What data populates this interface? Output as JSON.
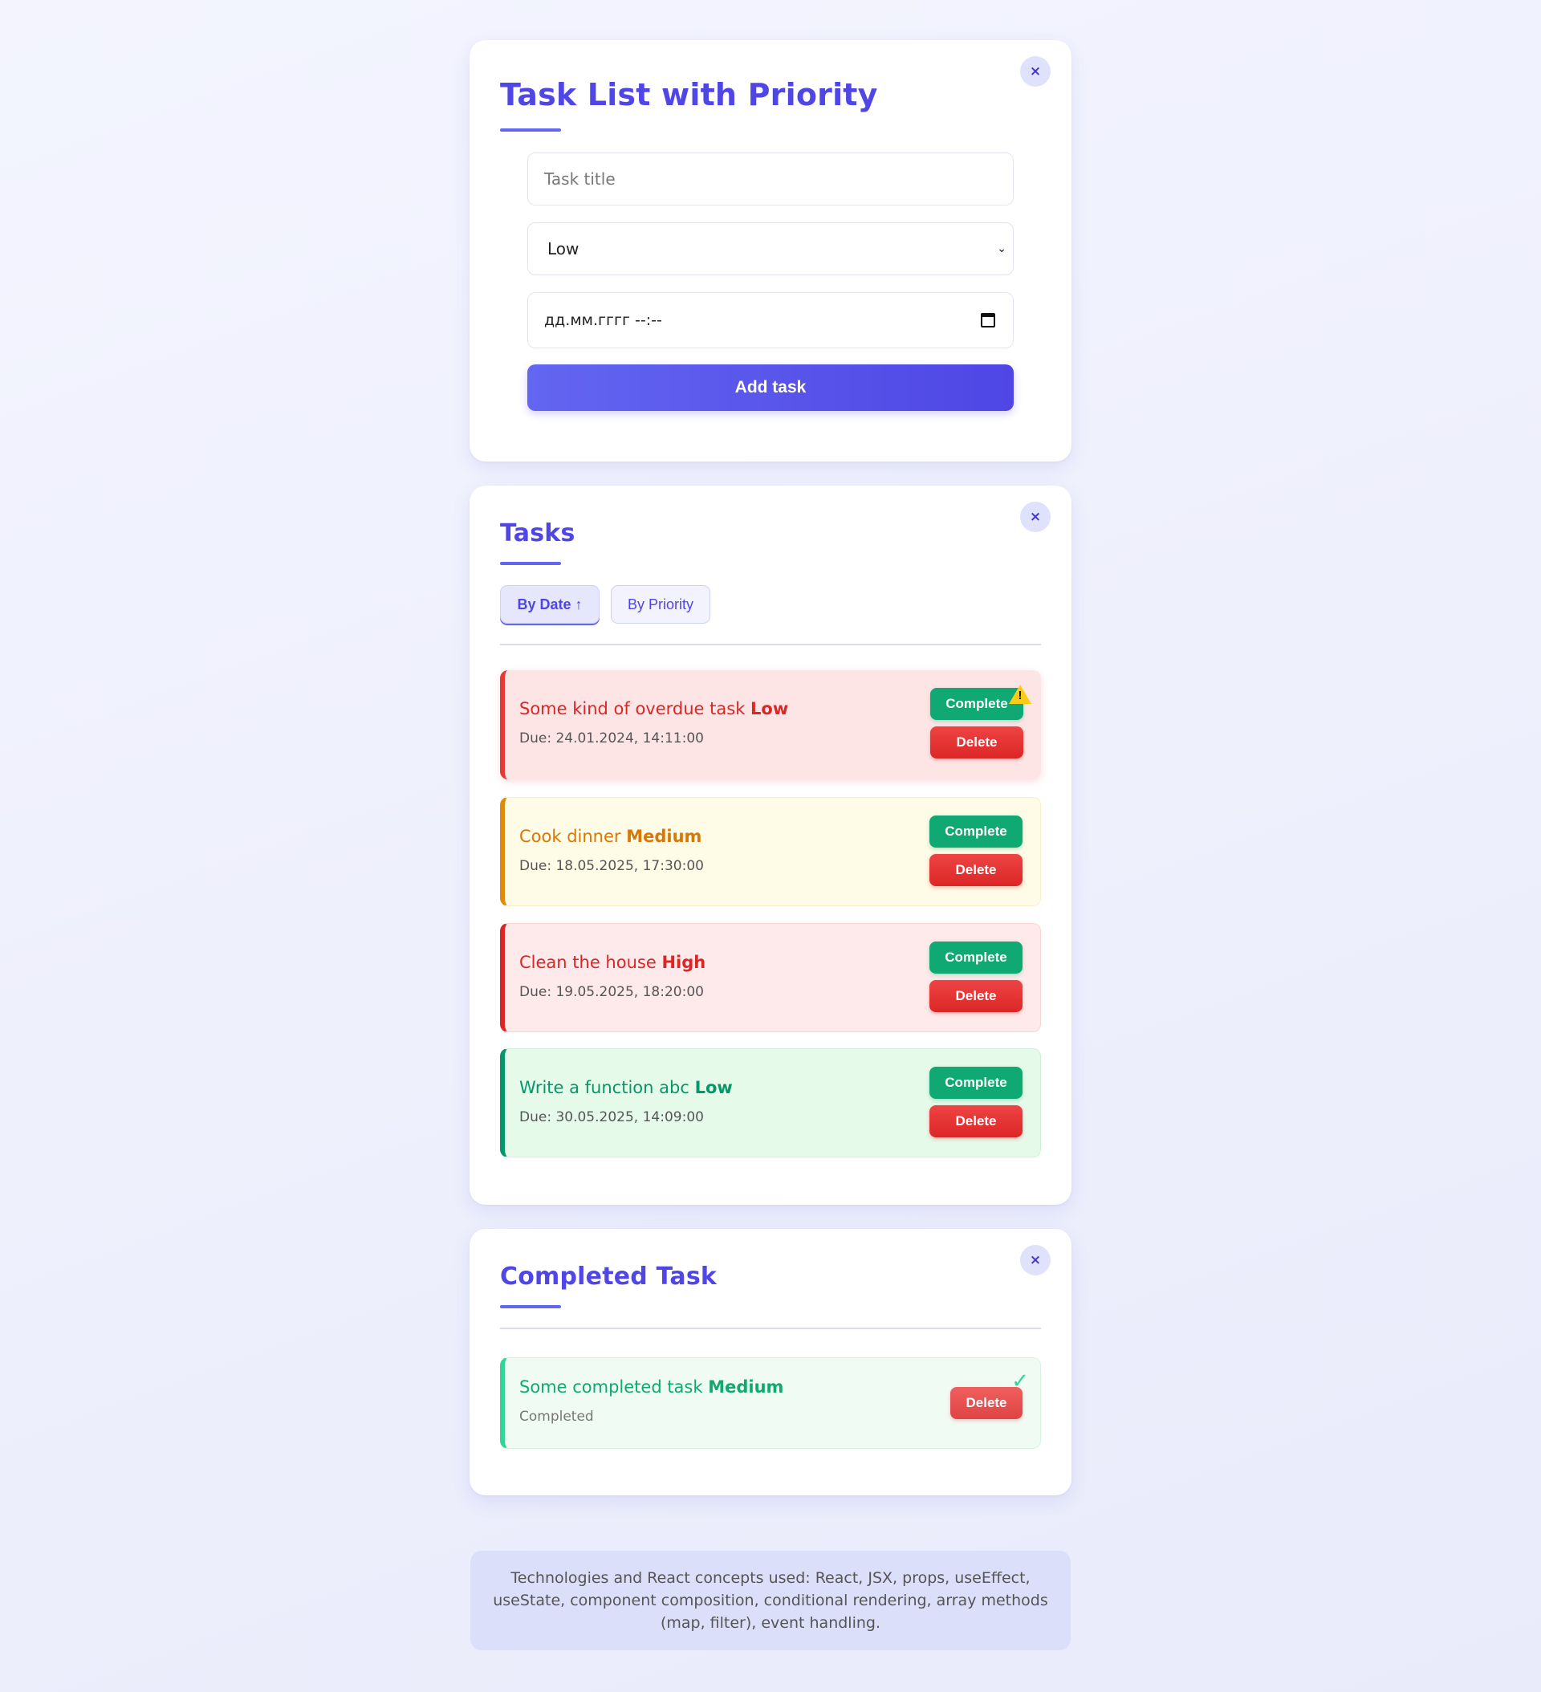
{
  "form_card": {
    "title": "Task List with Priority",
    "close_icon": "×",
    "title_input_placeholder": "Task title",
    "priority_selected": "Low",
    "datetime_placeholder": "дд.мм.гггг --:--",
    "add_button": "Add task"
  },
  "tasks_card": {
    "title": "Tasks",
    "close_icon": "×",
    "sort_by_date": "By Date ↑",
    "sort_by_priority": "By Priority",
    "tasks": [
      {
        "name": "Some kind of overdue task",
        "priority": "Low",
        "due": "Due: 24.01.2024, 14:11:00",
        "complete": "Complete",
        "delete": "Delete",
        "overdue_icon": "⚠"
      },
      {
        "name": "Cook dinner",
        "priority": "Medium",
        "due": "Due: 18.05.2025, 17:30:00",
        "complete": "Complete",
        "delete": "Delete"
      },
      {
        "name": "Clean the house",
        "priority": "High",
        "due": "Due: 19.05.2025, 18:20:00",
        "complete": "Complete",
        "delete": "Delete"
      },
      {
        "name": "Write a function abc",
        "priority": "Low",
        "due": "Due: 30.05.2025, 14:09:00",
        "complete": "Complete",
        "delete": "Delete"
      }
    ]
  },
  "completed_card": {
    "title": "Completed Task",
    "close_icon": "×",
    "tasks": [
      {
        "name": "Some completed task",
        "priority": "Medium",
        "status": "Completed",
        "delete": "Delete",
        "check_icon": "✓"
      }
    ]
  },
  "footer": {
    "text": "Technologies and React concepts used: React, JSX, props, useEffect, useState, component composition, conditional rendering, array methods (map, filter), event handling."
  },
  "colors": {
    "accent": "#4f46e5",
    "overdue_bg": "#fee5e5",
    "overdue_text": "#dc2626",
    "medium_bg": "#fefbe6",
    "medium_text": "#d97706",
    "high_bg": "#feeaea",
    "high_text": "#dc2626",
    "low_bg": "#e6faea",
    "low_text": "#059669",
    "completed_bg": "#f0fbf4",
    "completed_text": "#10a973"
  }
}
